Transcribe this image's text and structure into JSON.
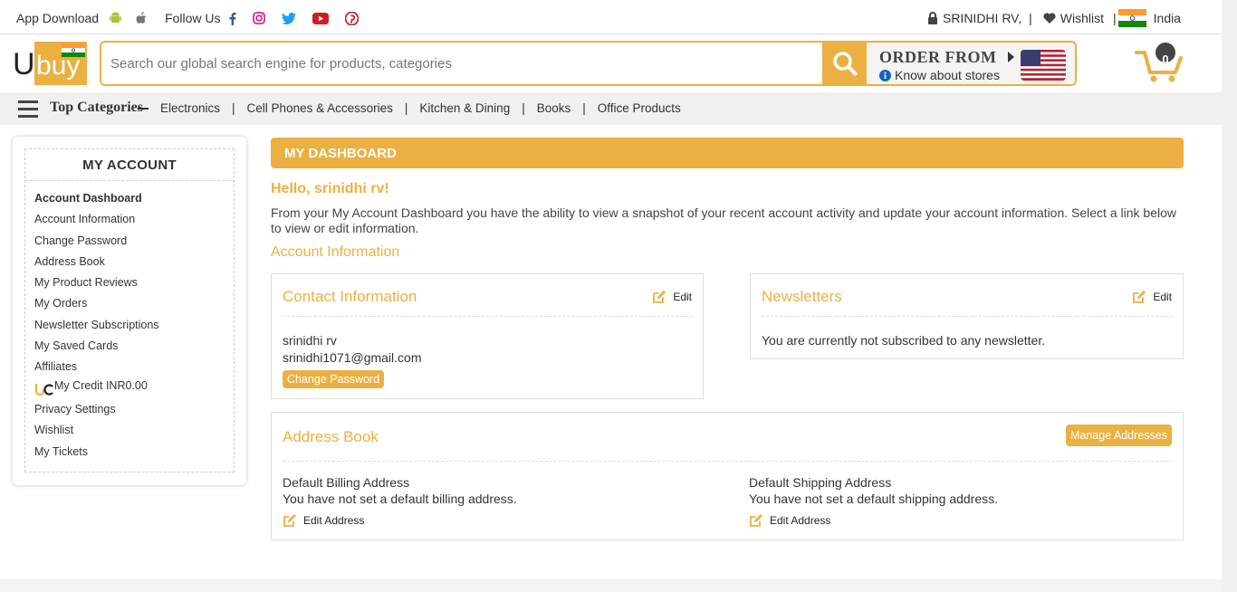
{
  "topbar": {
    "app_download": "App Download",
    "follow_us": "Follow Us",
    "user": "SRINIDHI RV,",
    "sep": "|",
    "wishlist": "Wishlist",
    "country": "India"
  },
  "header": {
    "search_placeholder": "Search our global search engine for products, categories",
    "order_from": "ORDER FROM",
    "know_stores": "Know about stores",
    "cart_count": "0"
  },
  "nav": {
    "top_categories": "Top Categories",
    "items": [
      "Electronics",
      "Cell Phones & Accessories",
      "Kitchen & Dining",
      "Books",
      "Office Products"
    ],
    "sep": "|"
  },
  "sidebar": {
    "title": "MY ACCOUNT",
    "items": [
      "Account Dashboard",
      "Account Information",
      "Change Password",
      "Address Book",
      "My Product Reviews",
      "My Orders",
      "Newsletter Subscriptions",
      "My Saved Cards",
      "Affiliates",
      "My Credit INR0.00",
      "Privacy Settings",
      "Wishlist",
      "My Tickets"
    ]
  },
  "main": {
    "banner": "MY DASHBOARD",
    "hello": "Hello, srinidhi rv!",
    "intro": "From your My Account Dashboard you have the ability to view a snapshot of your recent account activity and update your account information. Select a link below to view or edit information.",
    "account_info": "Account Information",
    "contact": {
      "title": "Contact Information",
      "edit": "Edit",
      "name": "srinidhi rv",
      "email": "srinidhi1071@gmail.com",
      "change_password": "Change Password"
    },
    "newsletters": {
      "title": "Newsletters",
      "edit": "Edit",
      "text": "You are currently not subscribed to any newsletter."
    },
    "address": {
      "title": "Address Book",
      "manage": "Manage Addresses",
      "billing_title": "Default Billing Address",
      "billing_text": "You have not set a default billing address.",
      "shipping_title": "Default Shipping Address",
      "shipping_text": "You have not set a default shipping address.",
      "edit_address": "Edit Address"
    }
  },
  "colors": {
    "accent": "#ebb041"
  }
}
